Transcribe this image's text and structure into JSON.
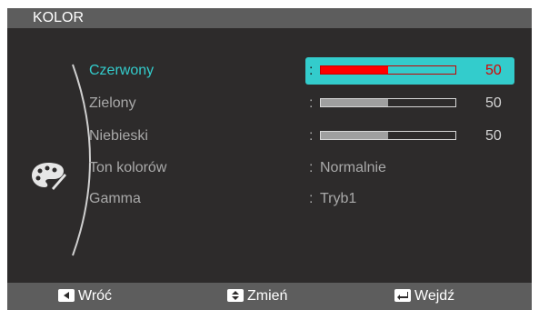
{
  "title": "KOLOR",
  "menu": [
    {
      "label": "Czerwony",
      "type": "slider",
      "value": 50,
      "max": 100
    },
    {
      "label": "Zielony",
      "type": "slider",
      "value": 50,
      "max": 100
    },
    {
      "label": "Niebieski",
      "type": "slider",
      "value": 50,
      "max": 100
    },
    {
      "label": "Ton kolorów",
      "type": "option",
      "value": "Normalnie"
    },
    {
      "label": "Gamma",
      "type": "option",
      "value": "Tryb1"
    }
  ],
  "separator": ":",
  "active_index": 0,
  "colors": {
    "accent": "#33cccc",
    "active_slider": "#ff0000",
    "background": "#2d2b2b",
    "bar": "#5d5d5d"
  },
  "bottom_bar": {
    "back": {
      "label": "Wróć",
      "icon": "left-arrow-key-icon"
    },
    "change": {
      "label": "Zmień",
      "icon": "up-down-arrow-key-icon"
    },
    "enter": {
      "label": "Wejdź",
      "icon": "enter-key-icon"
    }
  },
  "menu_icon": "color-palette-icon"
}
